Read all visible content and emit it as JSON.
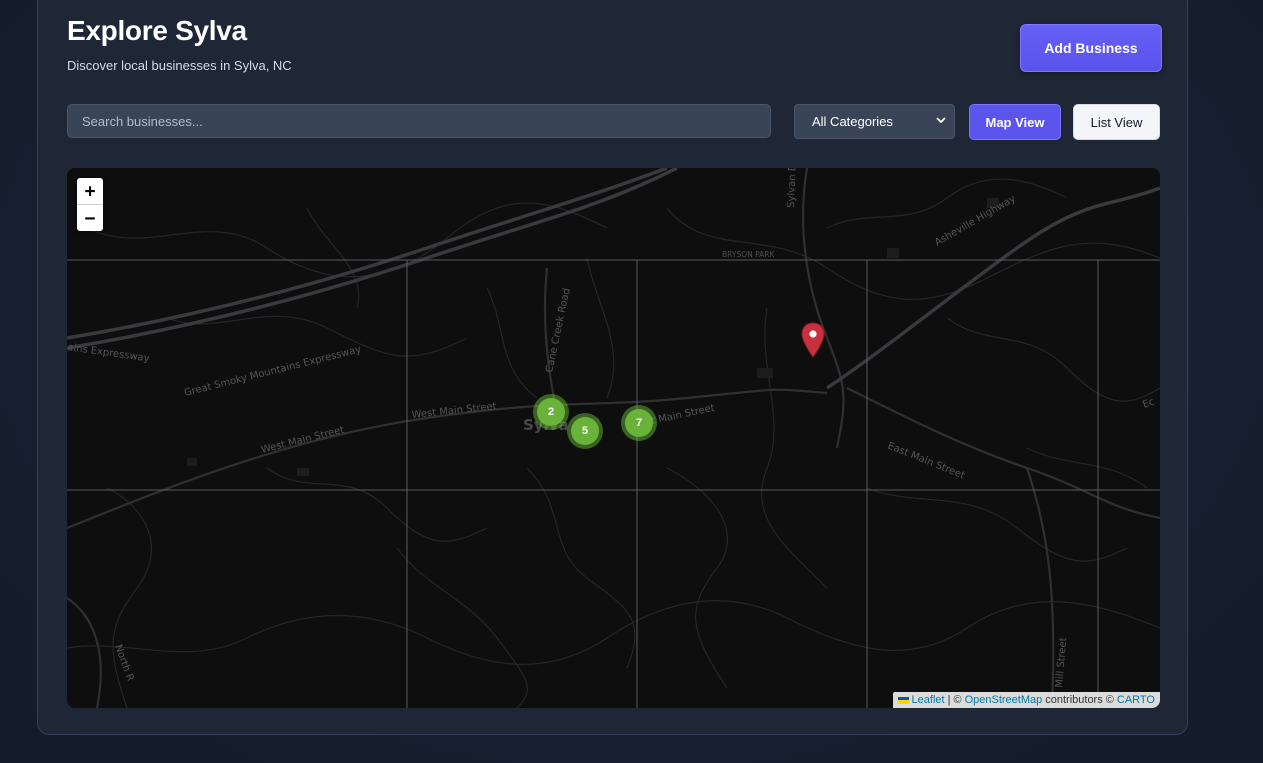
{
  "header": {
    "title": "Explore Sylva",
    "subtitle": "Discover local businesses in Sylva, NC",
    "add_business_label": "Add Business"
  },
  "filters": {
    "search_placeholder": "Search businesses...",
    "category_selected": "All Categories",
    "map_view_label": "Map View",
    "list_view_label": "List View"
  },
  "map": {
    "zoom_in": "+",
    "zoom_out": "−",
    "street_labels": {
      "expressway": "Great Smoky Mountains Expressway",
      "expressway_left": "ains Expressway",
      "west_main_1": "West Main Street",
      "west_main_2": "West Main Street",
      "main_st": "t Main Street",
      "east_main": "East Main Street",
      "asheville_hwy": "Asheville Highway",
      "cane_creek": "Cane Creek Road",
      "bryson_park": "BRYSON PARK",
      "sylva": "Sylva",
      "north_r": "North R",
      "sylvan": "Sylvan D",
      "mill_st": "Mill Street",
      "ecc": "Ec"
    },
    "clusters": [
      {
        "count": "2"
      },
      {
        "count": "5"
      },
      {
        "count": "7"
      }
    ],
    "attribution": {
      "leaflet": "Leaflet",
      "sep": "| ©",
      "osm": "OpenStreetMap",
      "contrib": "contributors ©",
      "carto": "CARTO"
    },
    "marker_icon": "map-pin-icon",
    "colors": {
      "cluster_fill": "#6ab33a",
      "marker": "#c8303e",
      "accent": "#5b54ed"
    }
  }
}
